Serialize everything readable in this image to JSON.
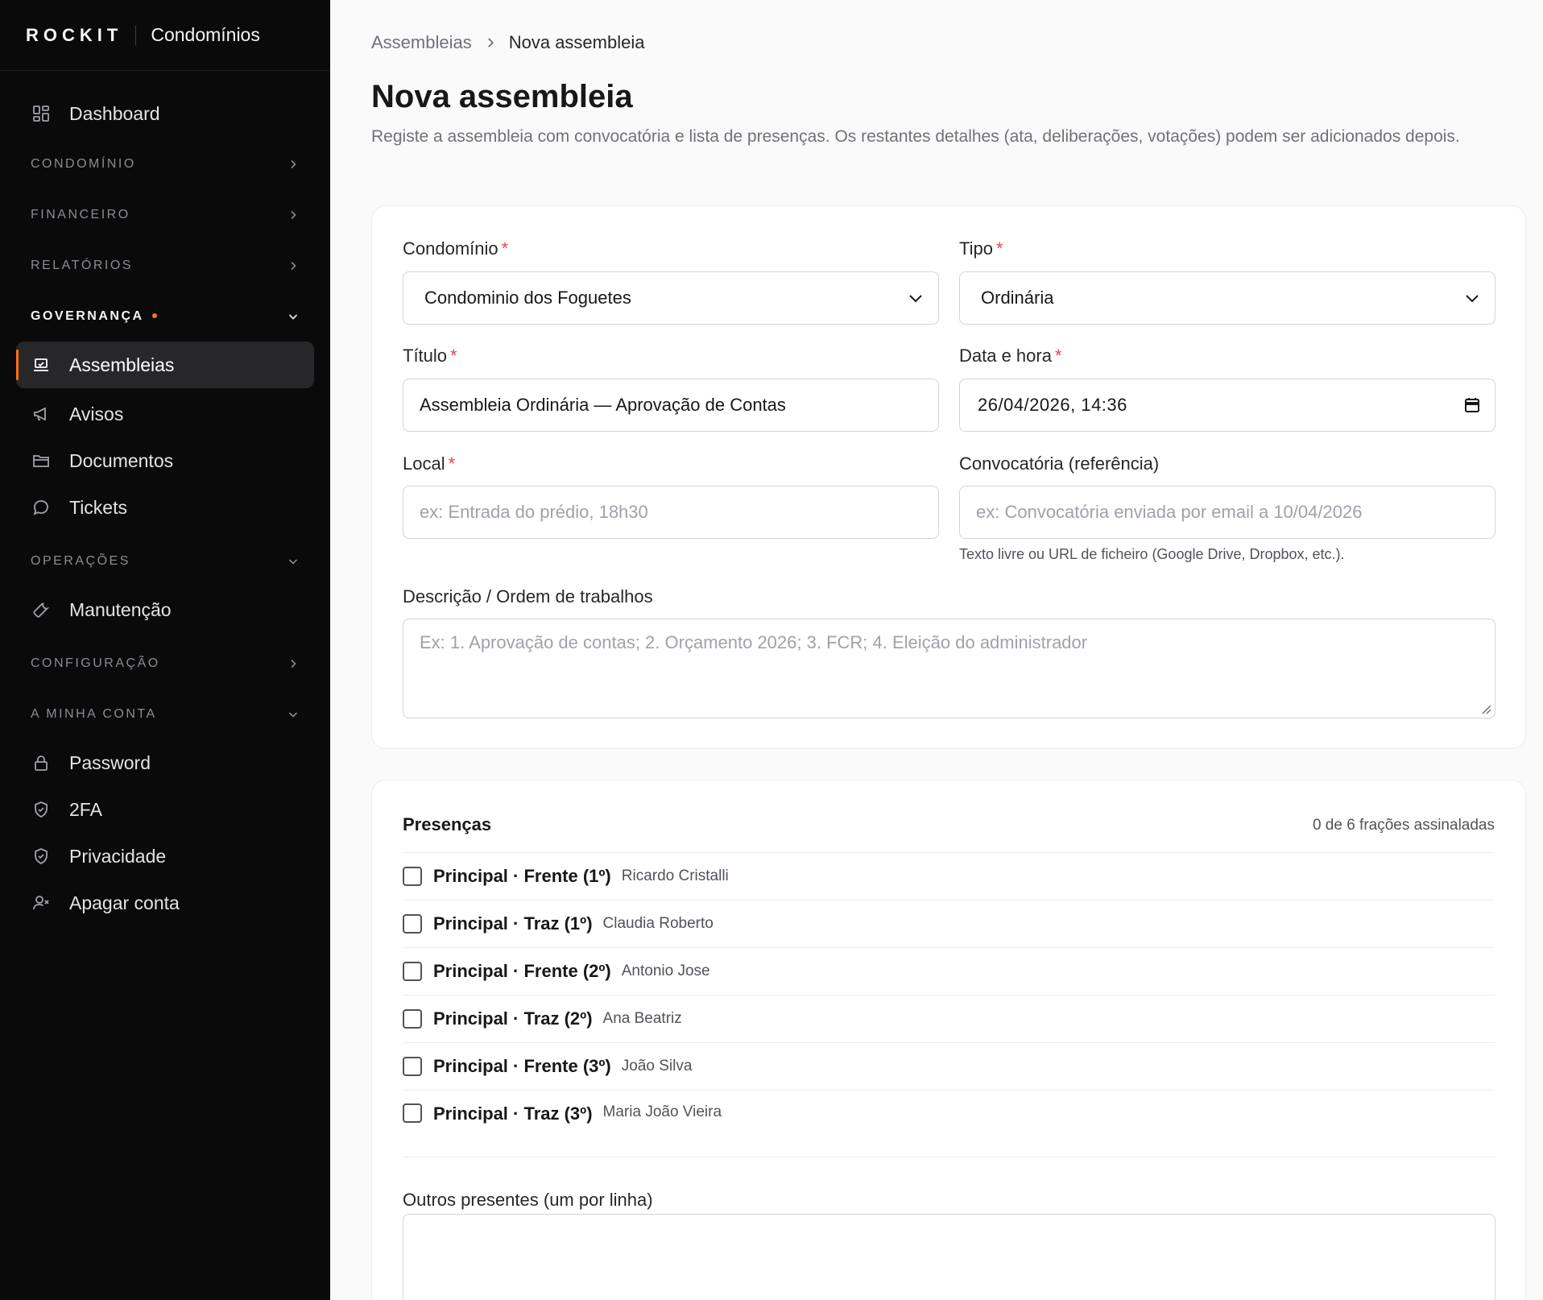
{
  "brand": {
    "logo": "ROCKIT",
    "name": "Condomínios"
  },
  "sidebar": {
    "dashboard": "Dashboard",
    "sections": {
      "condominio": "CONDOMÍNIO",
      "financeiro": "FINANCEIRO",
      "relatorios": "RELATÓRIOS",
      "governanca": "GOVERNANÇA",
      "operacoes": "OPERAÇÕES",
      "configuracao": "CONFIGURAÇÃO",
      "conta": "A MINHA CONTA"
    },
    "governanca_items": [
      "Assembleias",
      "Avisos",
      "Documentos",
      "Tickets"
    ],
    "operacoes_items": [
      "Manutenção"
    ],
    "conta_items": [
      "Password",
      "2FA",
      "Privacidade",
      "Apagar conta"
    ]
  },
  "breadcrumb": {
    "parent": "Assembleias",
    "current": "Nova assembleia"
  },
  "page": {
    "title": "Nova assembleia",
    "description": "Registe a assembleia com convocatória e lista de presenças. Os restantes detalhes (ata, deliberações, votações) podem ser adicionados depois."
  },
  "form": {
    "condominio": {
      "label": "Condomínio",
      "value": "Condominio dos Foguetes"
    },
    "tipo": {
      "label": "Tipo",
      "value": "Ordinária"
    },
    "titulo": {
      "label": "Título",
      "value": "Assembleia Ordinária — Aprovação de Contas"
    },
    "data_hora": {
      "label": "Data e hora",
      "value": "26/04/2026, 14:36"
    },
    "local": {
      "label": "Local",
      "placeholder": "ex: Entrada do prédio, 18h30"
    },
    "convocatoria": {
      "label": "Convocatória (referência)",
      "placeholder": "ex: Convocatória enviada por email a 10/04/2026",
      "hint": "Texto livre ou URL de ficheiro (Google Drive, Dropbox, etc.)."
    },
    "descricao": {
      "label": "Descrição / Ordem de trabalhos",
      "placeholder": "Ex: 1. Aprovação de contas; 2. Orçamento 2026; 3. FCR; 4. Eleição do administrador"
    },
    "required_mark": "*"
  },
  "presencas": {
    "title": "Presenças",
    "count": "0 de 6 frações assinaladas",
    "rows": [
      {
        "unit": "Principal · Frente (1º)",
        "name": "Ricardo Cristalli"
      },
      {
        "unit": "Principal · Traz (1º)",
        "name": "Claudia Roberto"
      },
      {
        "unit": "Principal · Frente (2º)",
        "name": "Antonio Jose"
      },
      {
        "unit": "Principal · Traz (2º)",
        "name": "Ana Beatriz"
      },
      {
        "unit": "Principal · Frente (3º)",
        "name": "João Silva"
      },
      {
        "unit": "Principal · Traz (3º)",
        "name": "Maria João Vieira"
      }
    ],
    "others_label": "Outros presentes (um por linha)"
  },
  "colors": {
    "accent": "#f97316",
    "required": "#ef4444",
    "sidebar_bg": "#0a0a0b"
  }
}
